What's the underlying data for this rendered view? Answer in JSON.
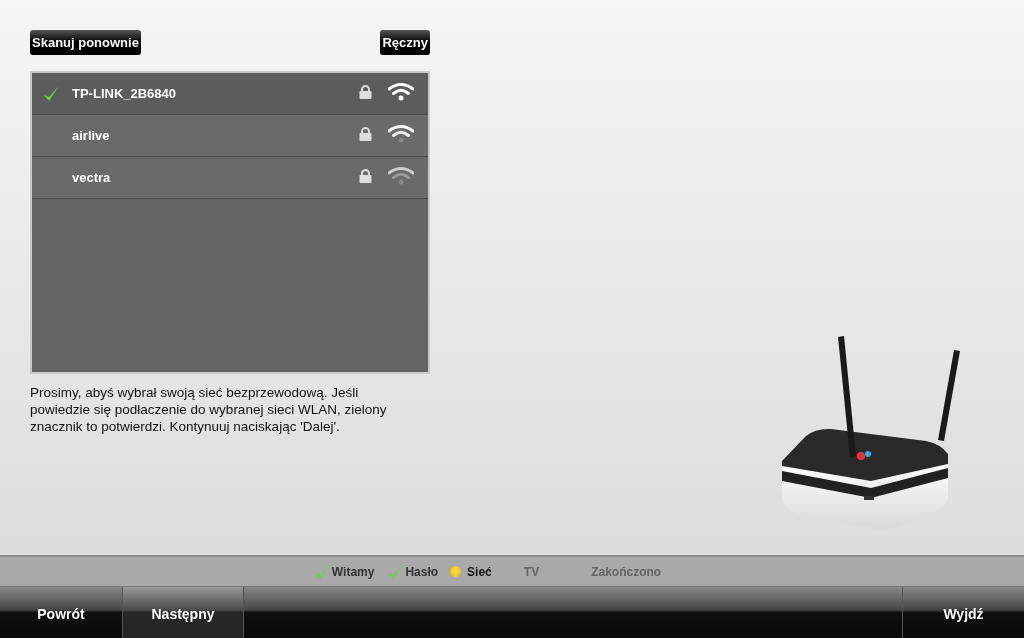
{
  "toolbar": {
    "rescan_button": "Skanuj ponownie",
    "manual_button": "Ręczny"
  },
  "networks": [
    {
      "name": "TP-LINK_2B6840",
      "connected": true,
      "locked": true,
      "kind": "strong"
    },
    {
      "name": "airlive",
      "connected": false,
      "locked": true,
      "kind": "medium"
    },
    {
      "name": "vectra",
      "connected": false,
      "locked": true,
      "kind": "weak"
    }
  ],
  "instructions": "Prosimy, abyś wybrał swoją sieć bezprzewodową. Jeśli powiedzie się podłaczenie do wybranej sieci WLAN, zielony znacznik to potwierdzi. Kontynuuj naciskając 'Dalej'.",
  "steps": [
    {
      "label": "Witamy",
      "kind": "done"
    },
    {
      "label": "Hasło",
      "kind": "done"
    },
    {
      "label": "Sieć",
      "kind": "current"
    },
    {
      "label": "TV",
      "kind": "pending"
    },
    {
      "label": "Zakończono",
      "kind": "pending"
    }
  ],
  "nav": [
    {
      "label": "Powrót",
      "selected": false
    },
    {
      "label": "Następny",
      "selected": true
    }
  ],
  "exit_button": "Wyjdź"
}
